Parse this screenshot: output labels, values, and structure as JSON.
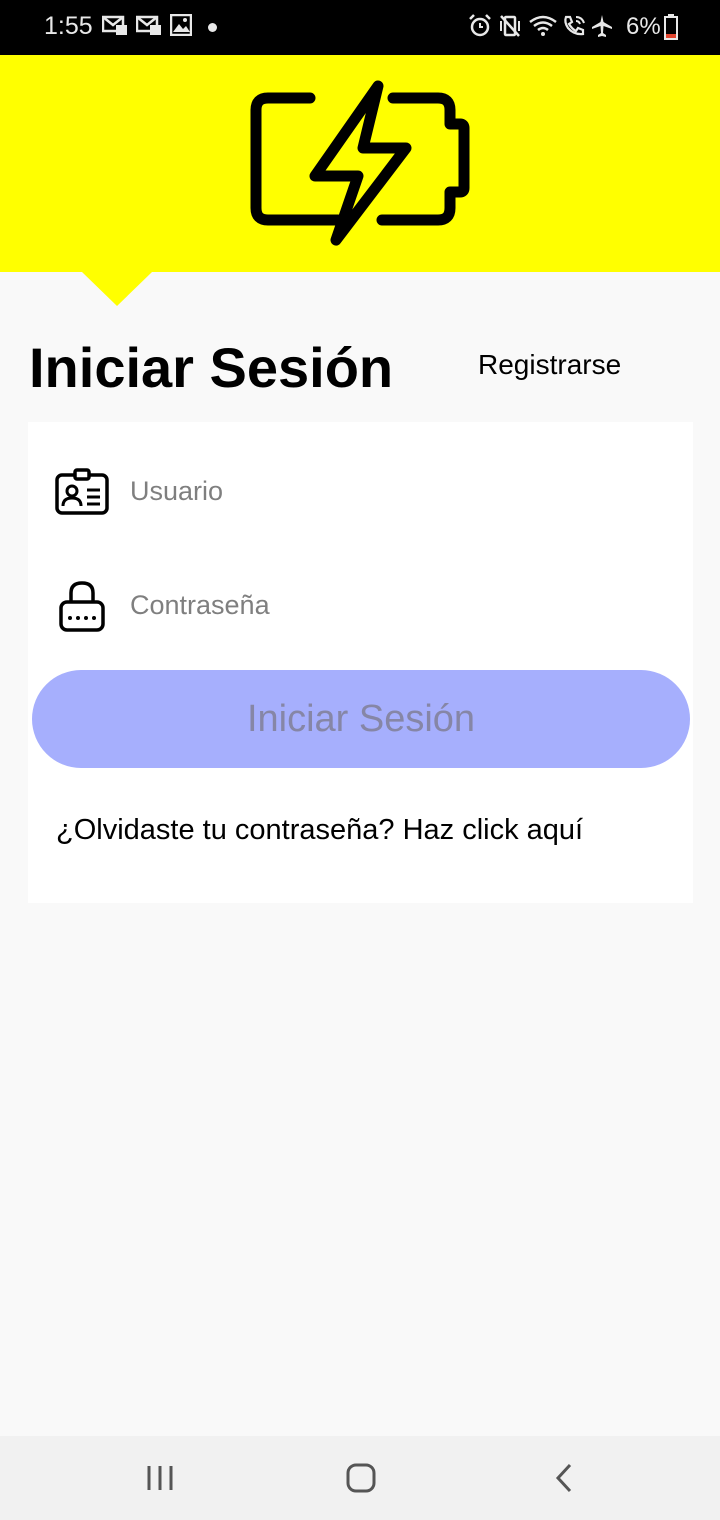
{
  "status_bar": {
    "time": "1:55",
    "battery": "6%",
    "left_icons": [
      "email-notification-icon",
      "email-notification-icon",
      "image-icon"
    ],
    "right_icons": [
      "alarm-icon",
      "vibrate-icon",
      "wifi-icon",
      "wifi-calling-icon",
      "airplane-mode-icon",
      "battery-low-icon"
    ]
  },
  "header": {
    "logo_icon": "battery-charging-icon",
    "background_color": "#ffff00"
  },
  "login": {
    "title": "Iniciar Sesión",
    "register_label": "Registrarse",
    "username_placeholder": "Usuario",
    "username_value": "",
    "password_placeholder": "Contraseña",
    "password_value": "",
    "submit_label": "Iniciar Sesión",
    "submit_color": "#a6affd",
    "forgot_label": "¿Olvidaste tu contraseña? Haz click aquí"
  },
  "nav_bar": {
    "buttons": [
      "recent-apps-icon",
      "home-icon",
      "back-icon"
    ]
  }
}
